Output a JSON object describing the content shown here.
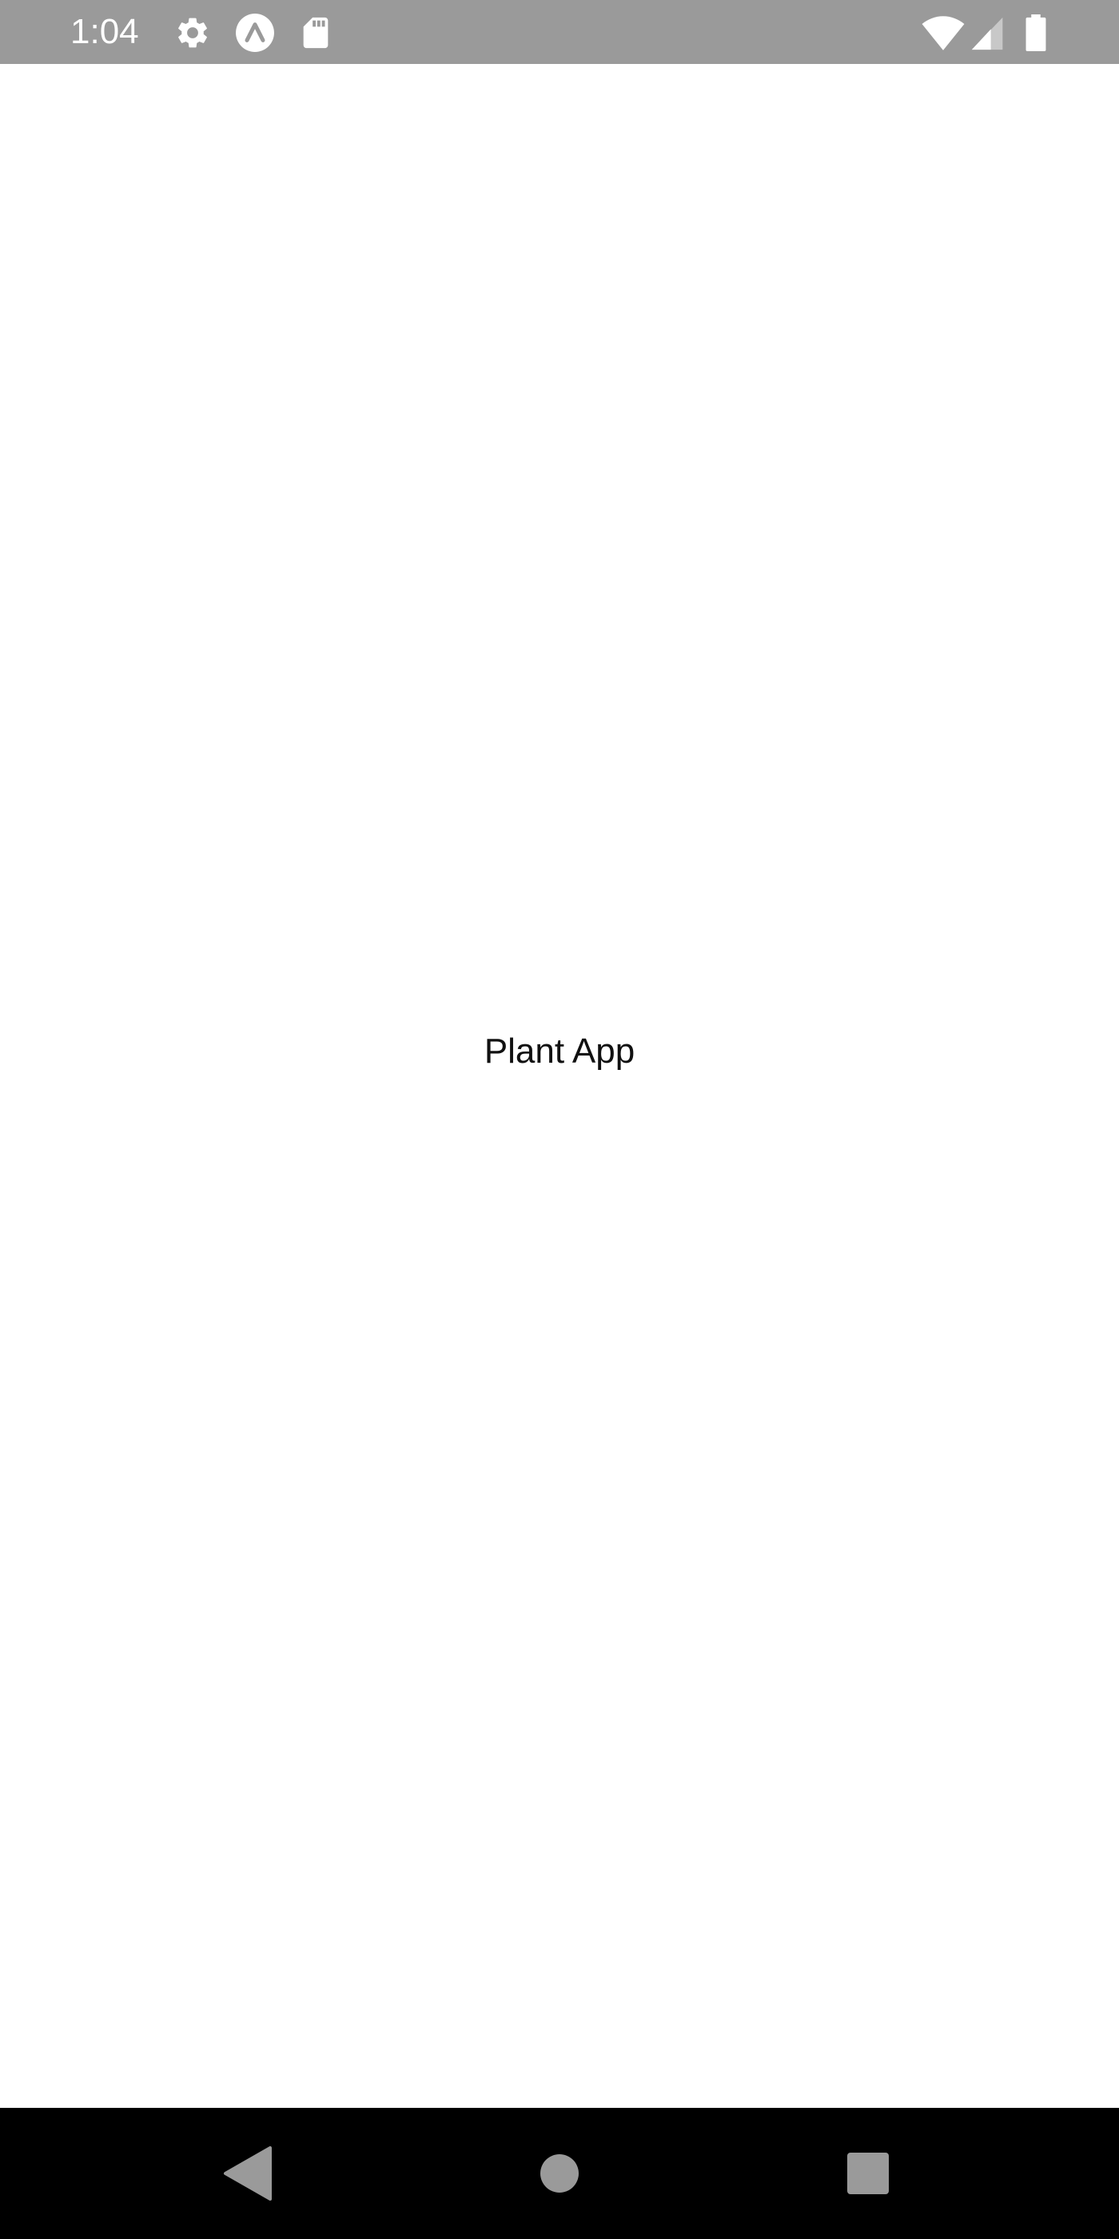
{
  "status_bar": {
    "time": "1:04",
    "background_color": "#9a9a9a",
    "left_icons": [
      "gear-icon",
      "expo-icon",
      "sd-card-icon"
    ],
    "right_icons": [
      "wifi-icon",
      "cell-signal-icon",
      "battery-icon"
    ]
  },
  "main": {
    "title": "Plant App",
    "background_color": "#ffffff"
  },
  "nav_bar": {
    "background_color": "#000000",
    "buttons": [
      "back-button",
      "home-button",
      "recents-button"
    ]
  }
}
